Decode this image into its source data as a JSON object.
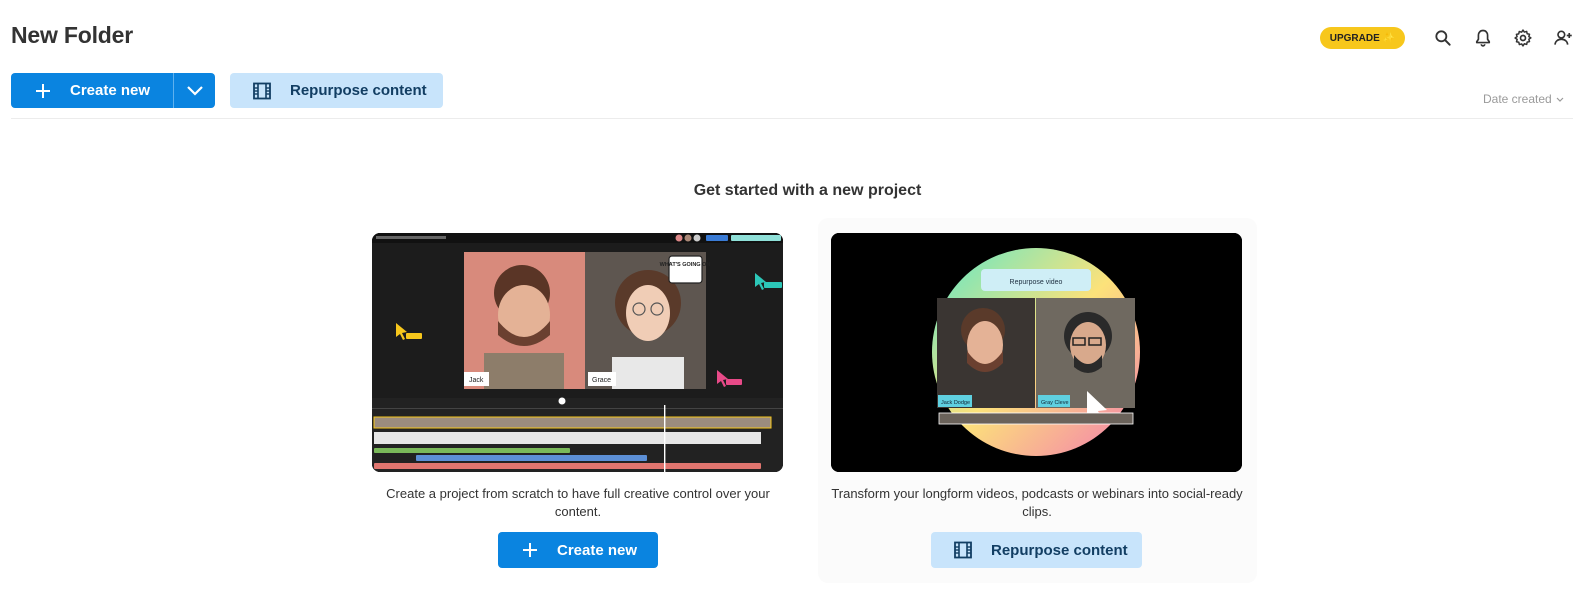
{
  "page": {
    "title": "New Folder"
  },
  "header": {
    "upgrade_label": "UPGRADE",
    "icons": [
      "search-icon",
      "bell-icon",
      "gear-icon",
      "add-user-icon"
    ]
  },
  "toolbar": {
    "create_label": "Create new",
    "repurpose_label": "Repurpose content",
    "sort_label": "Date created"
  },
  "main": {
    "heading": "Get started with a new project",
    "cards": [
      {
        "description": "Create a project from scratch to have full creative control over your content.",
        "button_label": "Create new",
        "thumbnail": {
          "speaker_left": "Jack",
          "speaker_right": "Grace",
          "speech_bubble": "WHAT'S GOING ON"
        }
      },
      {
        "description": "Transform your longform videos, podcasts or webinars into social-ready clips.",
        "button_label": "Repurpose content",
        "thumbnail": {
          "pill_label": "Repurpose video",
          "speaker_left": "Jack Dodge",
          "speaker_right": "Gray Cleve"
        }
      }
    ]
  },
  "colors": {
    "primary": "#0a84e0",
    "secondary_bg": "#c8e4fb",
    "secondary_text": "#123e63",
    "upgrade": "#f7c71c"
  }
}
